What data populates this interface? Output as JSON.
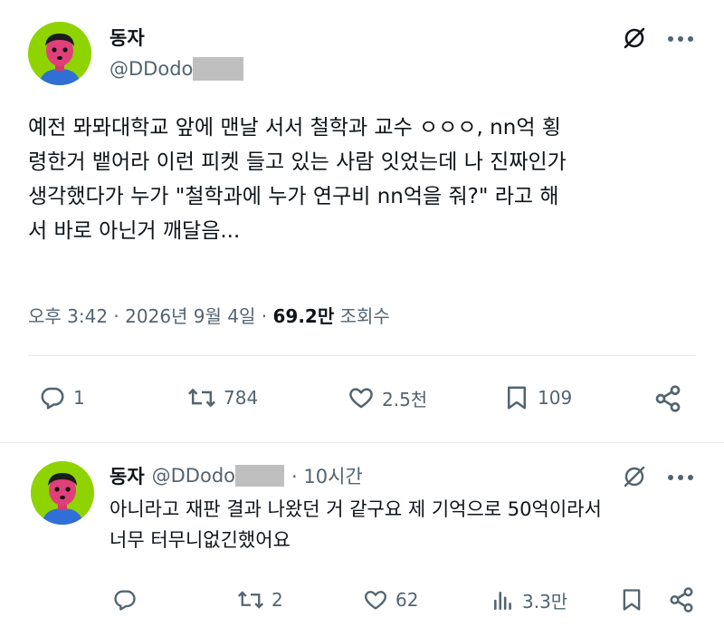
{
  "tweet": {
    "name": "동자",
    "handle": "@DDodo",
    "body": "예전 뫄뫄대학교 앞에 맨날 서서 철학과 교수 ㅇㅇㅇ, nn억 횡\n령한거 뱉어라 이런 피켓 들고 있는 사람 잇었는데 나 진짜인가\n생각했다가 누가 \"철학과에 누가 연구비 nn억을 줘?\" 라고 해\n서 바로 아닌거 깨달음...",
    "time": "오후 3:42 · 2026년 9월 4일 · ",
    "views_count": "69.2만",
    "views_label": " 조회수",
    "actions": {
      "replies": "1",
      "retweets": "784",
      "likes": "2.5천",
      "bookmarks": "109"
    }
  },
  "reply": {
    "name": "동자",
    "handle": "@DDodo",
    "time": "· 10시간",
    "body": "아니라고 재판 결과 나왔던 거 같구요 제 기억으로 50억이라서\n너무 터무니없긴했어요",
    "actions": {
      "replies": "",
      "retweets": "2",
      "likes": "62",
      "views": "3.3만"
    }
  },
  "colors": {
    "avatar_bg": "#8fd400",
    "text": "#0f1419",
    "muted": "#536471",
    "divider": "#e7e9ea"
  }
}
